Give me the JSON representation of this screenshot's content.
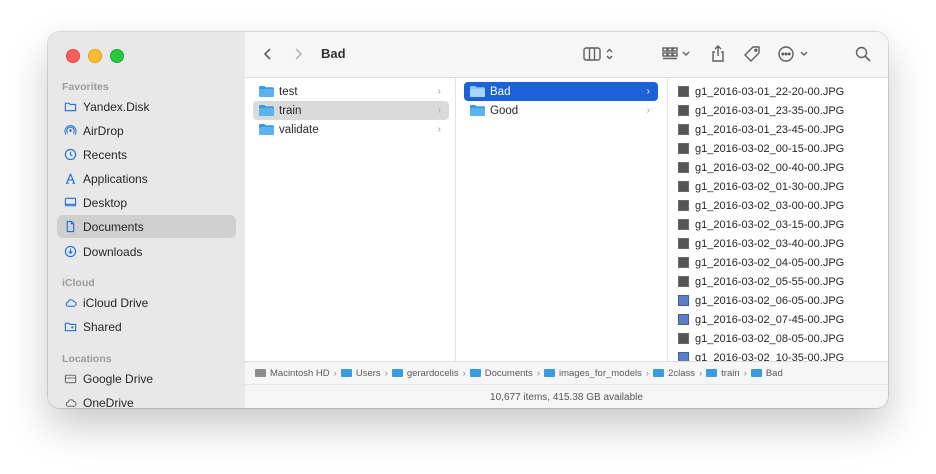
{
  "window": {
    "title": "Bad"
  },
  "sidebar": {
    "favorites_title": "Favorites",
    "icloud_title": "iCloud",
    "locations_title": "Locations",
    "favorites": [
      {
        "label": "Yandex.Disk",
        "icon": "folder-icon"
      },
      {
        "label": "AirDrop",
        "icon": "airdrop-icon"
      },
      {
        "label": "Recents",
        "icon": "clock-icon"
      },
      {
        "label": "Applications",
        "icon": "applications-icon"
      },
      {
        "label": "Desktop",
        "icon": "desktop-icon"
      },
      {
        "label": "Documents",
        "icon": "document-icon",
        "selected": true
      },
      {
        "label": "Downloads",
        "icon": "download-icon"
      }
    ],
    "icloud": [
      {
        "label": "iCloud Drive",
        "icon": "cloud-icon"
      },
      {
        "label": "Shared",
        "icon": "shared-folder-icon"
      }
    ],
    "locations": [
      {
        "label": "Google Drive",
        "icon": "drive-icon"
      },
      {
        "label": "OneDrive",
        "icon": "cloud-icon"
      }
    ]
  },
  "columns": {
    "col1": [
      "test",
      "train",
      "validate"
    ],
    "col2": [
      "Bad",
      "Good"
    ],
    "col3": [
      "g1_2016-03-01_22-20-00.JPG",
      "g1_2016-03-01_23-35-00.JPG",
      "g1_2016-03-01_23-45-00.JPG",
      "g1_2016-03-02_00-15-00.JPG",
      "g1_2016-03-02_00-40-00.JPG",
      "g1_2016-03-02_01-30-00.JPG",
      "g1_2016-03-02_03-00-00.JPG",
      "g1_2016-03-02_03-15-00.JPG",
      "g1_2016-03-02_03-40-00.JPG",
      "g1_2016-03-02_04-05-00.JPG",
      "g1_2016-03-02_05-55-00.JPG",
      "g1_2016-03-02_06-05-00.JPG",
      "g1_2016-03-02_07-45-00.JPG",
      "g1_2016-03-02_08-05-00.JPG",
      "g1_2016-03-02_10-35-00.JPG"
    ]
  },
  "pathbar": [
    "Macintosh HD",
    "Users",
    "gerardocelis",
    "Documents",
    "images_for_models",
    "2class",
    "train",
    "Bad"
  ],
  "status": "10,677 items, 415.38 GB available",
  "colors": {
    "accent": "#1b62d8",
    "folder": "#3a9be0",
    "sidebar_icon": "#1f6fe0"
  }
}
